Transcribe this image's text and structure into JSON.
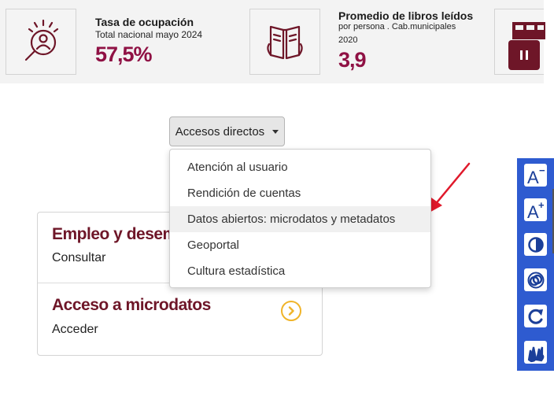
{
  "stats": [
    {
      "title": "Tasa de ocupación",
      "subtitle": "Total nacional mayo 2024",
      "value": "57,5%",
      "icon": "search-person-icon"
    },
    {
      "title": "Promedio de libros leídos",
      "subtitle_line1": "por persona . Cab.municipales",
      "subtitle_line2": "2020",
      "value": "3,9",
      "icon": "open-book-icon"
    }
  ],
  "carousel": {
    "pause_icon": "pause-icon"
  },
  "accesos": {
    "toggle_label": "Accesos directos",
    "items": [
      "Atención al usuario",
      "Rendición de cuentas",
      "Datos abiertos: microdatos y metadatos",
      "Geoportal",
      "Cultura estadística"
    ],
    "highlighted_index": 2
  },
  "cards": [
    {
      "title": "Empleo y desempleo",
      "link": "Consultar"
    },
    {
      "title": "Acceso a microdatos",
      "link": "Acceder"
    }
  ],
  "accessibility": {
    "buttons": [
      {
        "name": "decrease-font",
        "label_main": "A",
        "label_sup": "−"
      },
      {
        "name": "increase-font",
        "label_main": "A",
        "label_sup": "+"
      },
      {
        "name": "contrast",
        "icon": "contrast-icon"
      },
      {
        "name": "grayscale",
        "icon": "desaturate-icon"
      },
      {
        "name": "reset",
        "icon": "reset-icon"
      },
      {
        "name": "sign-language",
        "icon": "sign-language-icon"
      }
    ]
  },
  "colors": {
    "brand_wine": "#6e1628",
    "value_magenta": "#8f1144",
    "accent_yellow": "#f0b429",
    "a11y_blue": "#2e5bd0",
    "annotation_red": "#e0192b"
  }
}
